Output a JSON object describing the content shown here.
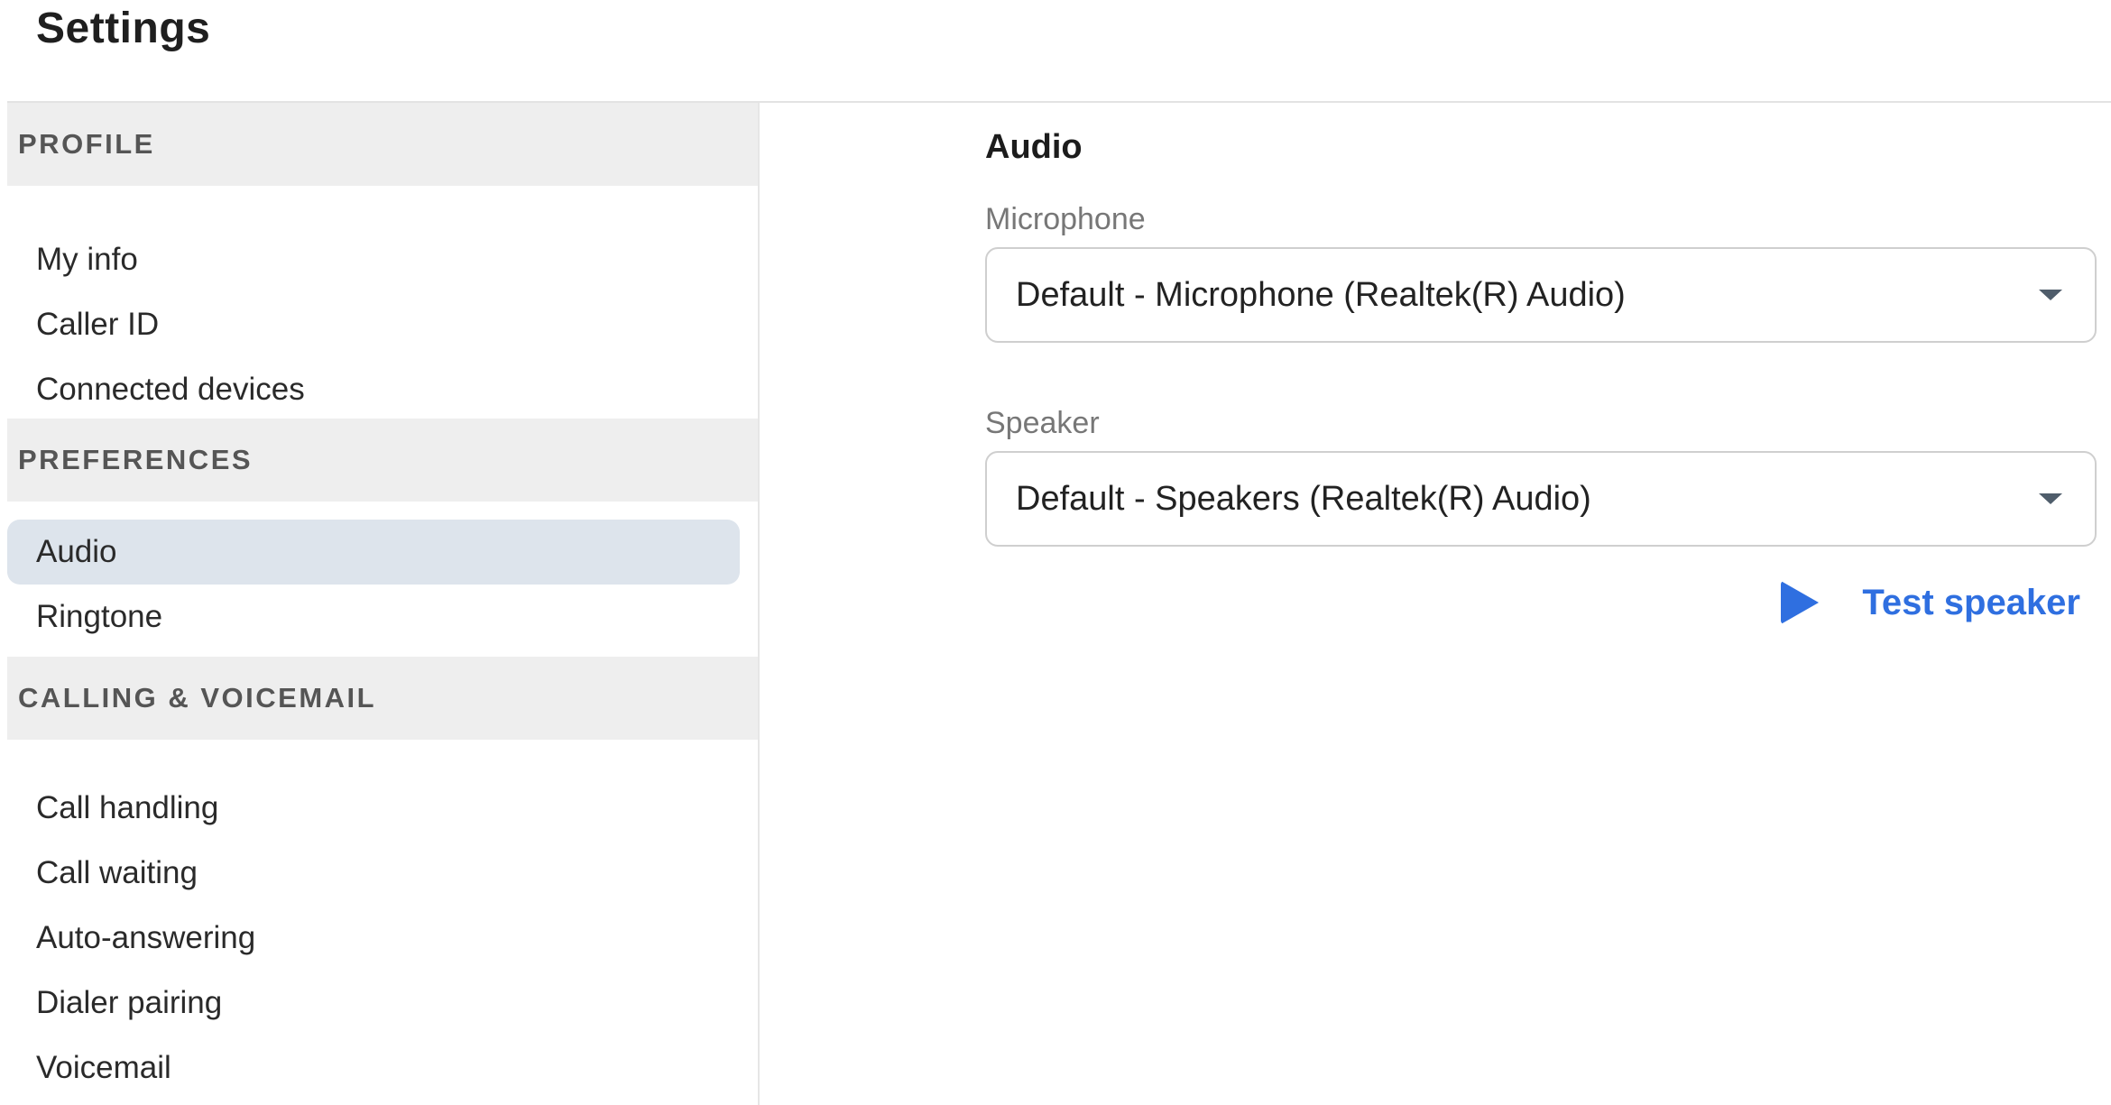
{
  "page": {
    "title": "Settings"
  },
  "sidebar": {
    "sections": [
      {
        "header": "PROFILE",
        "items": [
          "My info",
          "Caller ID",
          "Connected devices"
        ]
      },
      {
        "header": "PREFERENCES",
        "items": [
          "Audio",
          "Ringtone"
        ]
      },
      {
        "header": "CALLING & VOICEMAIL",
        "items": [
          "Call handling",
          "Call waiting",
          "Auto-answering",
          "Dialer pairing",
          "Voicemail"
        ]
      }
    ],
    "active_item": "Audio"
  },
  "main": {
    "heading": "Audio",
    "microphone": {
      "label": "Microphone",
      "value": "Default - Microphone (Realtek(R) Audio)"
    },
    "speaker": {
      "label": "Speaker",
      "value": "Default - Speakers (Realtek(R) Audio)"
    },
    "test_speaker": {
      "label": "Test speaker",
      "icon": "play-icon",
      "color": "#2f6fe0"
    }
  }
}
